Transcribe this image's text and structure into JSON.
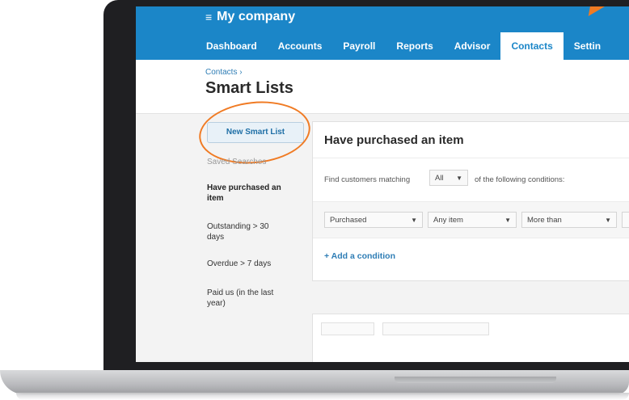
{
  "app": {
    "company": "My company",
    "menu_icon": "≡"
  },
  "nav": [
    "Dashboard",
    "Accounts",
    "Payroll",
    "Reports",
    "Advisor",
    "Contacts",
    "Settin"
  ],
  "nav_active": "Contacts",
  "breadcrumb": "Contacts ›",
  "page_title": "Smart Lists",
  "sidebar": {
    "new_button": "New Smart List",
    "saved_label": "Saved Searches",
    "items": [
      "Have purchased an item",
      "Outstanding > 30 days",
      "Overdue > 7 days",
      "Paid us (in the last year)"
    ]
  },
  "panel": {
    "title": "Have purchased an item",
    "match_prefix": "Find customers matching",
    "match_value": "All",
    "match_suffix": "of the following conditions:",
    "condition": {
      "field": "Purchased",
      "item": "Any item",
      "comparison": "More than"
    },
    "add_condition": "+ Add a condition"
  },
  "colors": {
    "brand": "#1b86c8",
    "highlight": "#f07b24",
    "link": "#2e7db5"
  }
}
